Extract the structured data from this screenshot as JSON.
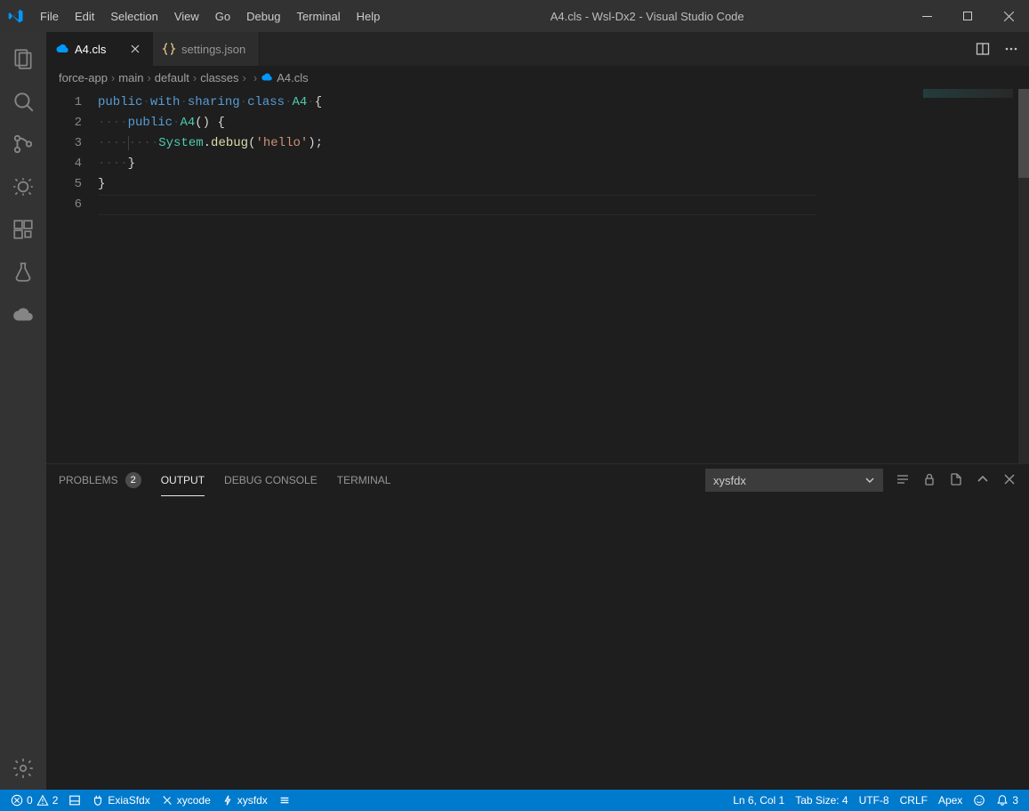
{
  "window": {
    "title": "A4.cls - Wsl-Dx2 - Visual Studio Code"
  },
  "menu": {
    "items": [
      "File",
      "Edit",
      "Selection",
      "View",
      "Go",
      "Debug",
      "Terminal",
      "Help"
    ]
  },
  "tabs": {
    "items": [
      {
        "label": "A4.cls",
        "active": true
      },
      {
        "label": "settings.json",
        "active": false
      }
    ]
  },
  "breadcrumbs": {
    "segments": [
      "force-app",
      "main",
      "default",
      "classes",
      "",
      "A4.cls"
    ]
  },
  "editor": {
    "line_count": 6,
    "code_tokens": [
      [
        {
          "t": "kw",
          "v": "public"
        },
        {
          "t": "ws",
          "v": " "
        },
        {
          "t": "kw",
          "v": "with"
        },
        {
          "t": "ws",
          "v": " "
        },
        {
          "t": "kw",
          "v": "sharing"
        },
        {
          "t": "ws",
          "v": " "
        },
        {
          "t": "kw",
          "v": "class"
        },
        {
          "t": "ws",
          "v": " "
        },
        {
          "t": "typ",
          "v": "A4"
        },
        {
          "t": "ws",
          "v": " "
        },
        {
          "t": "pln",
          "v": "{"
        }
      ],
      [
        {
          "t": "ind",
          "v": 4
        },
        {
          "t": "kw",
          "v": "public"
        },
        {
          "t": "ws",
          "v": " "
        },
        {
          "t": "typ",
          "v": "A4"
        },
        {
          "t": "pln",
          "v": "() {"
        }
      ],
      [
        {
          "t": "ind",
          "v": 8
        },
        {
          "t": "typ",
          "v": "System"
        },
        {
          "t": "pln",
          "v": "."
        },
        {
          "t": "fn",
          "v": "debug"
        },
        {
          "t": "pln",
          "v": "("
        },
        {
          "t": "str",
          "v": "'hello'"
        },
        {
          "t": "pln",
          "v": ");"
        }
      ],
      [
        {
          "t": "ind",
          "v": 4
        },
        {
          "t": "pln",
          "v": "}"
        }
      ],
      [
        {
          "t": "pln",
          "v": "}"
        }
      ],
      []
    ],
    "current_line": 6
  },
  "panel": {
    "tabs": {
      "problems": "PROBLEMS",
      "problems_badge": "2",
      "output": "OUTPUT",
      "debug_console": "DEBUG CONSOLE",
      "terminal": "TERMINAL"
    },
    "dropdown": "xysfdx"
  },
  "statusbar": {
    "errors": "0",
    "warnings": "2",
    "ext1": "ExiaSfdx",
    "ext2": "xycode",
    "ext3": "xysfdx",
    "cursor": "Ln 6, Col 1",
    "tabsize": "Tab Size: 4",
    "encoding": "UTF-8",
    "eol": "CRLF",
    "language": "Apex",
    "notifications": "3"
  }
}
